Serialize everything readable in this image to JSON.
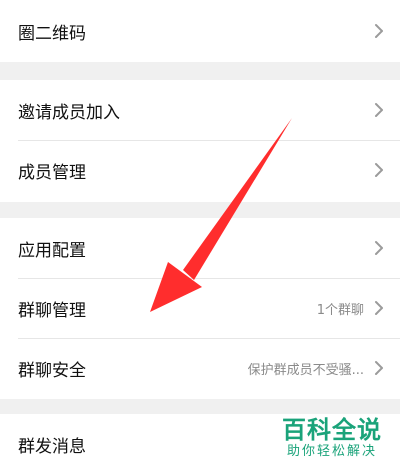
{
  "groups": [
    {
      "items": [
        {
          "label": "圈二维码",
          "value": ""
        }
      ]
    },
    {
      "items": [
        {
          "label": "邀请成员加入",
          "value": ""
        },
        {
          "label": "成员管理",
          "value": ""
        }
      ]
    },
    {
      "items": [
        {
          "label": "应用配置",
          "value": ""
        },
        {
          "label": "群聊管理",
          "value": "1个群聊"
        },
        {
          "label": "群聊安全",
          "value": "保护群成员不受骚..."
        }
      ]
    },
    {
      "items": [
        {
          "label": "群发消息",
          "value": ""
        }
      ]
    }
  ],
  "icons": {
    "row_chevron": "chevron-right-icon"
  },
  "colors": {
    "annotation_arrow": "#ff2d2d",
    "watermark": "#1aa37a",
    "background": "#f0f0f0"
  },
  "watermark": {
    "title": "百科全说",
    "subtitle": "助你轻松解决"
  }
}
